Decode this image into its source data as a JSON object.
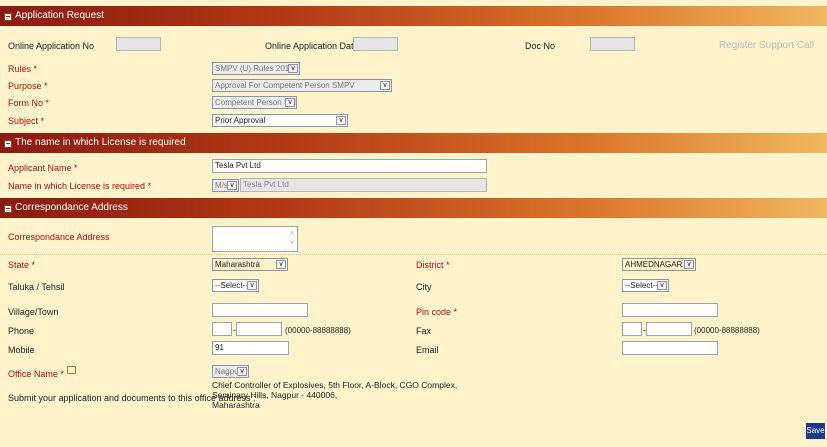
{
  "sections": {
    "application_request": "Application Request",
    "license_name": "The name in which License is required",
    "correspondance": "Correspondance Address"
  },
  "top": {
    "online_app_no_label": "Online Application No",
    "online_app_date_label": "Online Application Date",
    "doc_no_label": "Doc No",
    "register_support_call": "Register Support Call"
  },
  "request": {
    "rules_label": "Rules *",
    "rules_value": "SMPV (U) Rules 2016",
    "purpose_label": "Purpose *",
    "purpose_value": "Approval For Competent Person SMPV",
    "form_no_label": "Form No *",
    "form_no_value": "Competent Person SMPV",
    "subject_label": "Subject *",
    "subject_value": "Prior Approval"
  },
  "license": {
    "applicant_name_label": "Applicant Name *",
    "applicant_name_value": "Tesla Pvt Ltd",
    "license_name_label": "Name in which License is required *",
    "title_value": "M/s.",
    "license_name_value": "Tesla Pvt Ltd"
  },
  "address": {
    "correspondance_label": "Correspondance Address",
    "state_label": "State *",
    "state_value": "Maharashtra",
    "district_label": "District *",
    "district_value": "AHMEDNAGAR",
    "taluka_label": "Taluka / Tehsil",
    "taluka_value": "--Select--",
    "city_label": "City",
    "city_value": "--Select--",
    "village_label": "Village/Town",
    "pincode_label": "Pin code *",
    "phone_label": "Phone",
    "phone_hint": "(00000-88888888)",
    "fax_label": "Fax",
    "fax_hint": "(00000-88888888)",
    "mobile_label": "Mobile",
    "mobile_value": "91",
    "email_label": "Email",
    "office_name_label": "Office Name *",
    "office_name_value": "Nagpur",
    "submit_label": "Submit your application and documents to this office address :",
    "office_address_lines": [
      "Chief Controller of Explosives, 5th Floor, A-Block, CGO Complex,",
      "Seminary Hills, Nagpur - 440006,",
      "Maharashtra"
    ]
  },
  "buttons": {
    "save": "Save"
  },
  "colors": {
    "page_bg": "#fff3cc",
    "header_dark": "#8a1a10",
    "header_light": "#f0b860",
    "required_label": "#b01010",
    "save_button": "#1a3a8a"
  },
  "icons": {
    "collapse": "minus-square-icon",
    "dropdown": "chevron-down-icon",
    "office_info": "speech-bubble-icon"
  }
}
